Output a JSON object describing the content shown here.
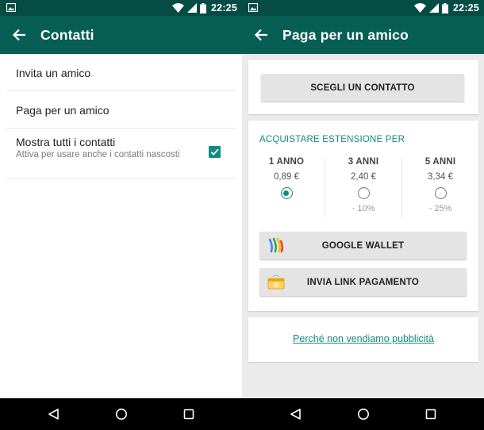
{
  "status": {
    "time": "22:25"
  },
  "left": {
    "title": "Contatti",
    "items": [
      {
        "label": "Invita un amico"
      },
      {
        "label": "Paga per un amico"
      },
      {
        "label": "Mostra tutti i contatti",
        "sub": "Attiva per usare anche i contatti nascosti",
        "checked": true
      }
    ]
  },
  "right": {
    "title": "Paga per un amico",
    "choose_contact": "SCEGLI UN CONTATTO",
    "section_title": "ACQUISTARE ESTENSIONE PER",
    "plans": [
      {
        "name": "1 ANNO",
        "price": "0,89 €",
        "discount": "",
        "selected": true
      },
      {
        "name": "3 ANNI",
        "price": "2,40 €",
        "discount": "- 10%",
        "selected": false
      },
      {
        "name": "5 ANNI",
        "price": "3,34 €",
        "discount": "- 25%",
        "selected": false
      }
    ],
    "google_wallet": "GOOGLE WALLET",
    "send_link": "INVIA LINK PAGAMENTO",
    "why_no_ads": "Perché non vendiamo pubblicità"
  },
  "colors": {
    "status_bar": "#054d44",
    "app_bar": "#075e54",
    "accent": "#128c7e"
  },
  "icons": [
    "gallery-icon",
    "wifi-icon",
    "signal-icon",
    "battery-icon",
    "back-arrow-icon",
    "checkbox-checked-icon",
    "google-wallet-icon",
    "payment-link-icon",
    "nav-back-icon",
    "nav-home-icon",
    "nav-recents-icon"
  ]
}
